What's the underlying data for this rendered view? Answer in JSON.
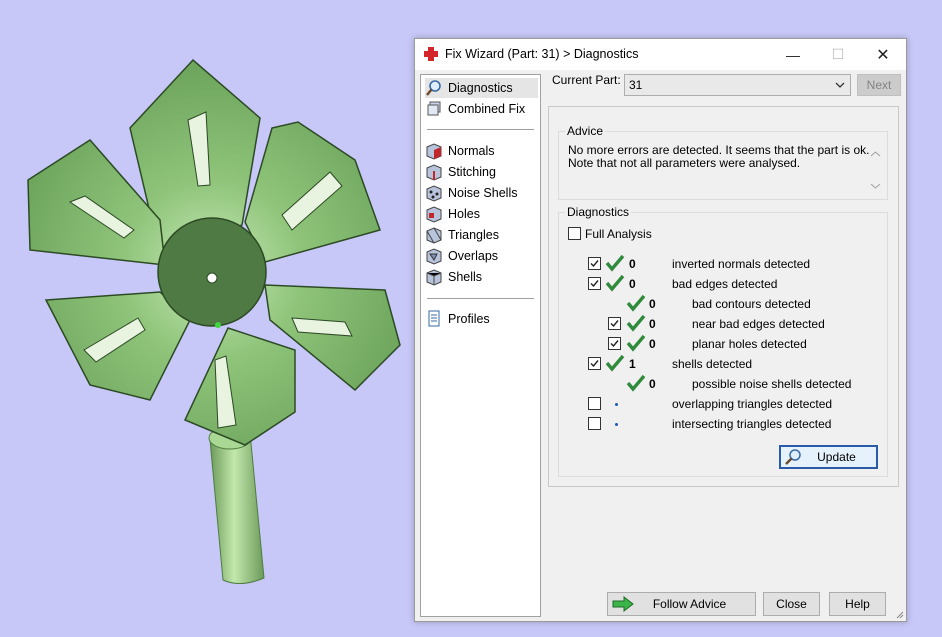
{
  "colors": {
    "background": "#c8c8f8",
    "leaf": "#8fc47a",
    "leaf_dark": "#4e7d40",
    "hub": "#4f7a44",
    "tick": "#2f8a3c",
    "update_border": "#2b5aa8",
    "follow_arrow": "#3bb54a"
  },
  "dialog": {
    "title": "Fix Wizard (Part: 31) > Diagnostics",
    "title_icon": "red-cross-icon",
    "minimize": "—",
    "maximize": "☐",
    "close": "✕"
  },
  "sidebar": {
    "items": [
      {
        "label": "Diagnostics",
        "icon": "magnifier-icon",
        "selected": true
      },
      {
        "label": "Combined Fix",
        "icon": "layers-icon"
      },
      {
        "label": "Normals",
        "icon": "normals-cube-icon"
      },
      {
        "label": "Stitching",
        "icon": "stitching-cube-icon"
      },
      {
        "label": "Noise Shells",
        "icon": "noise-shells-icon"
      },
      {
        "label": "Holes",
        "icon": "holes-cube-icon"
      },
      {
        "label": "Triangles",
        "icon": "triangles-cube-icon"
      },
      {
        "label": "Overlaps",
        "icon": "overlaps-cube-icon"
      },
      {
        "label": "Shells",
        "icon": "shells-cube-icon"
      },
      {
        "label": "Profiles",
        "icon": "profiles-document-icon"
      }
    ]
  },
  "header": {
    "current_part_label": "Current Part:",
    "current_part_value": "31",
    "next_label": "Next"
  },
  "advice": {
    "title": "Advice",
    "line1": "No more errors are detected. It seems that the part is ok.",
    "line2": "Note that not all parameters were analysed."
  },
  "diagnostics": {
    "title": "Diagnostics",
    "full_analysis_label": "Full Analysis",
    "full_analysis_checked": false,
    "rows": [
      {
        "checkbox": true,
        "checked": true,
        "status": "ok",
        "count": "0",
        "label": "inverted normals detected",
        "indent": 0
      },
      {
        "checkbox": true,
        "checked": true,
        "status": "ok",
        "count": "0",
        "label": "bad edges detected",
        "indent": 0
      },
      {
        "checkbox": false,
        "status": "ok",
        "count": "0",
        "label": "bad contours detected",
        "indent": 1
      },
      {
        "checkbox": true,
        "checked": true,
        "status": "ok",
        "count": "0",
        "label": "near bad edges detected",
        "indent": 1
      },
      {
        "checkbox": true,
        "checked": true,
        "status": "ok",
        "count": "0",
        "label": "planar holes detected",
        "indent": 1
      },
      {
        "checkbox": true,
        "checked": true,
        "status": "ok",
        "count": "1",
        "label": "shells detected",
        "indent": 0
      },
      {
        "checkbox": false,
        "status": "ok",
        "count": "0",
        "label": "possible noise shells detected",
        "indent": 1
      },
      {
        "checkbox": true,
        "checked": false,
        "status": "dot",
        "count": "",
        "label": "overlapping triangles detected",
        "indent": 0
      },
      {
        "checkbox": true,
        "checked": false,
        "status": "dot",
        "count": "",
        "label": "intersecting triangles detected",
        "indent": 0
      }
    ],
    "update_label": "Update"
  },
  "footer": {
    "follow_advice_label": "Follow Advice",
    "close_label": "Close",
    "help_label": "Help"
  }
}
